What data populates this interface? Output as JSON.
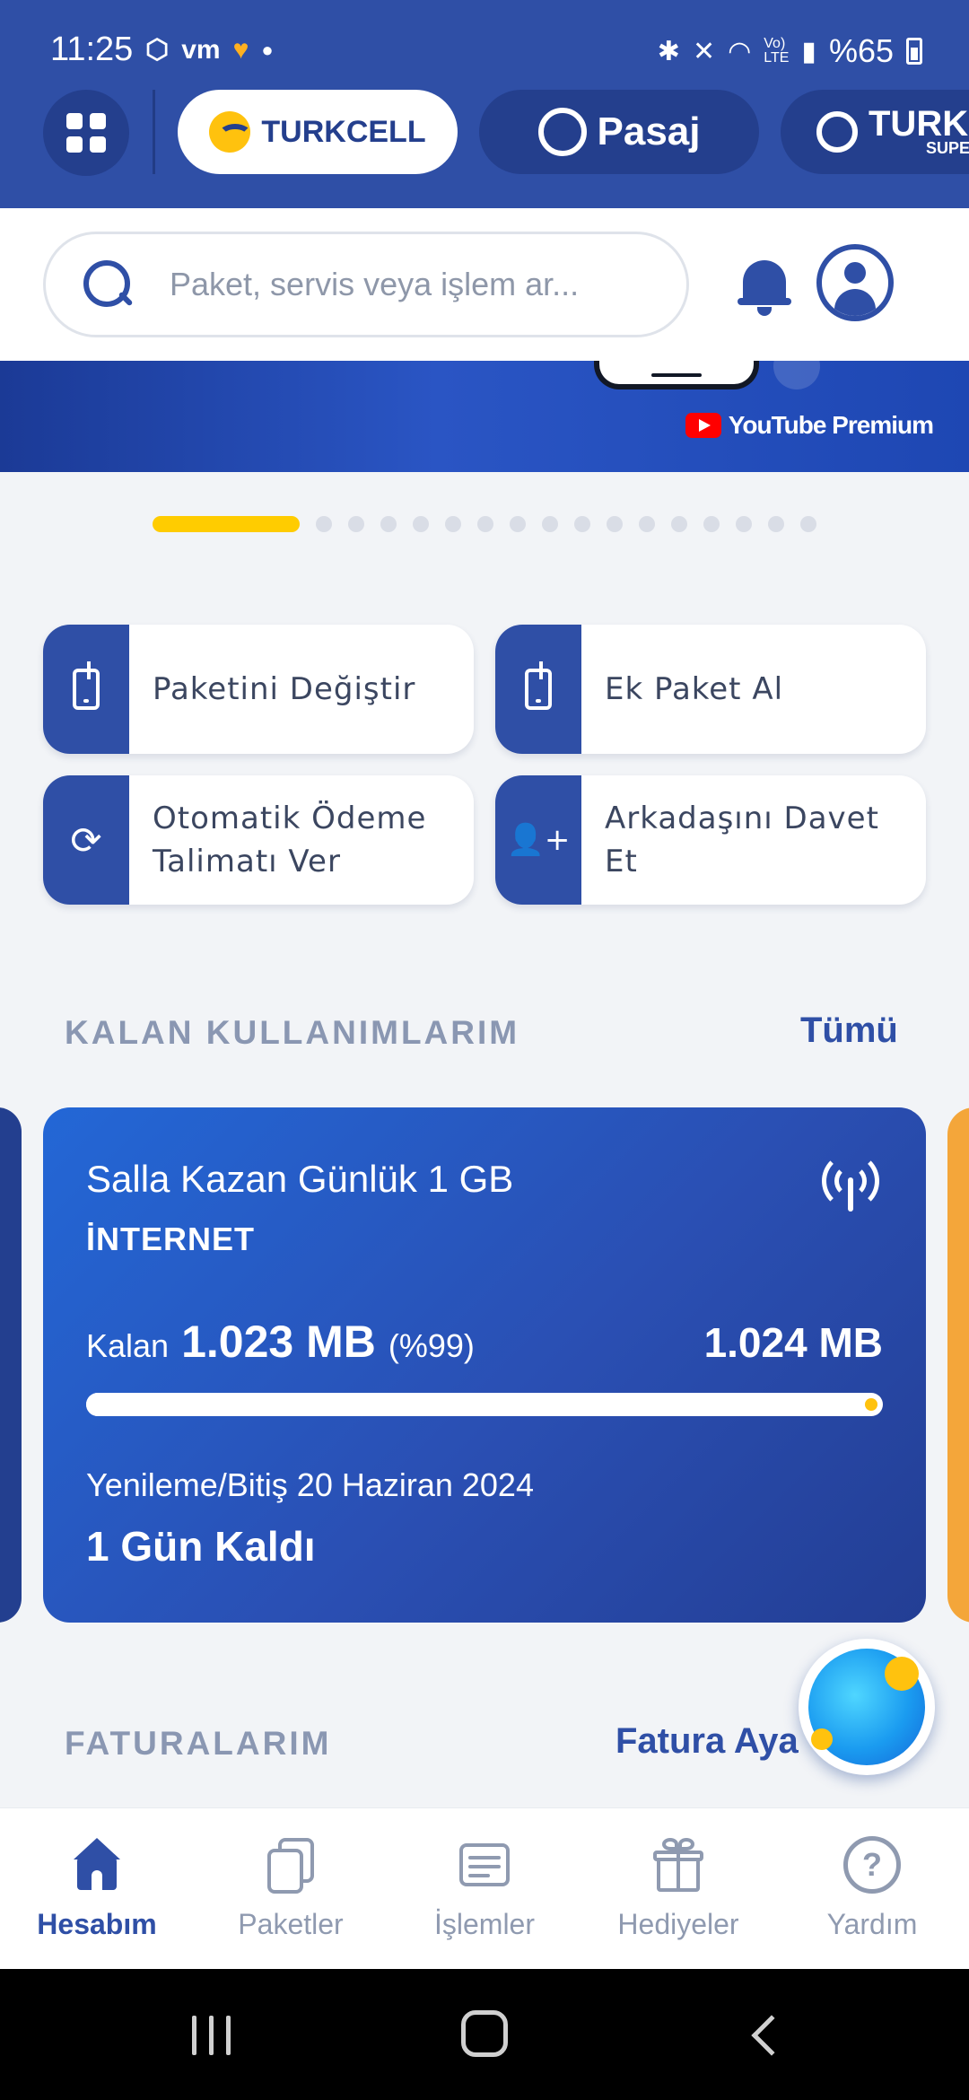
{
  "status_bar": {
    "time": "11:25",
    "carrier_short": "vm",
    "battery": "%65",
    "icons": [
      "bluetooth-icon",
      "mute-icon",
      "wifi-icon",
      "volte-icon",
      "signal-icon",
      "battery-icon"
    ]
  },
  "brand_tabs": [
    {
      "label": "TURKCELL",
      "active": true
    },
    {
      "label": "Pasaj",
      "active": false
    },
    {
      "label": "TURKC",
      "sublabel": "SUPERO",
      "active": false
    }
  ],
  "search": {
    "placeholder": "Paket, servis veya işlem ar..."
  },
  "banner": {
    "badge": "YouTube Premium",
    "slide_count": 17,
    "active_slide": 1
  },
  "quick_actions": [
    {
      "label": "Paketini Değiştir",
      "icon": "phone-upload-icon"
    },
    {
      "label": "Ek Paket Al",
      "icon": "phone-add-icon"
    },
    {
      "label": "Otomatik Ödeme Talimatı Ver",
      "icon": "refresh-icon"
    },
    {
      "label": "Arkadaşını Davet Et",
      "icon": "add-user-icon"
    }
  ],
  "usage_section": {
    "title": "KALAN KULLANIMLARIM",
    "link": "Tümü",
    "card": {
      "name": "Salla Kazan Günlük 1 GB",
      "type": "İNTERNET",
      "remaining_label": "Kalan",
      "remaining_amount": "1.023 MB",
      "remaining_percent": "(%99)",
      "total": "1.024 MB",
      "progress_fraction": 0.99,
      "renewal_text": "Yenileme/Bitiş 20 Haziran 2024",
      "days_left": "1 Gün Kaldı"
    }
  },
  "invoices_section": {
    "title": "FATURALARIM",
    "link": "Fatura Aya"
  },
  "bottom_nav": [
    {
      "label": "Hesabım",
      "active": true
    },
    {
      "label": "Paketler",
      "active": false
    },
    {
      "label": "İşlemler",
      "active": false
    },
    {
      "label": "Hediyeler",
      "active": false
    },
    {
      "label": "Yardım",
      "active": false
    }
  ],
  "colors": {
    "brand_blue": "#2f4fa6",
    "brand_yellow": "#ffc20e",
    "background": "#f2f4f7"
  }
}
